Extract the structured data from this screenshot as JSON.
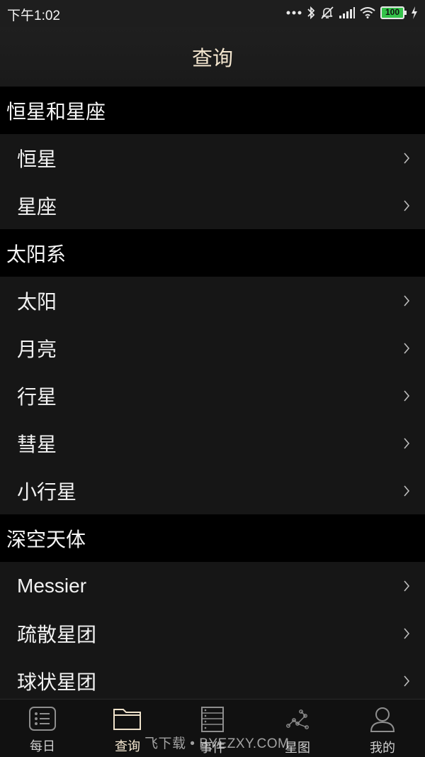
{
  "status_bar": {
    "time": "下午1:02",
    "battery": "100",
    "icons": [
      "more-dots-icon",
      "bluetooth-icon",
      "mute-icon",
      "signal-icon",
      "wifi-icon",
      "battery-icon",
      "charging-icon"
    ]
  },
  "header": {
    "title": "查询"
  },
  "sections": [
    {
      "title": "恒星和星座",
      "items": [
        "恒星",
        "星座"
      ]
    },
    {
      "title": "太阳系",
      "items": [
        "太阳",
        "月亮",
        "行星",
        "彗星",
        "小行星"
      ]
    },
    {
      "title": "深空天体",
      "items": [
        "Messier",
        "疏散星团",
        "球状星团"
      ]
    }
  ],
  "tabs": [
    {
      "label": "每日",
      "icon": "list-icon",
      "active": false
    },
    {
      "label": "查询",
      "icon": "folder-icon",
      "active": true
    },
    {
      "label": "事件",
      "icon": "server-icon",
      "active": false
    },
    {
      "label": "星图",
      "icon": "constellation-icon",
      "active": false
    },
    {
      "label": "我的",
      "icon": "user-icon",
      "active": false
    }
  ],
  "watermark": "飞下载 • BYEZXY.COM",
  "colors": {
    "title": "#f4e6cf",
    "section_bg": "#000000",
    "row_bg": "#161616",
    "battery": "#34c24a"
  }
}
